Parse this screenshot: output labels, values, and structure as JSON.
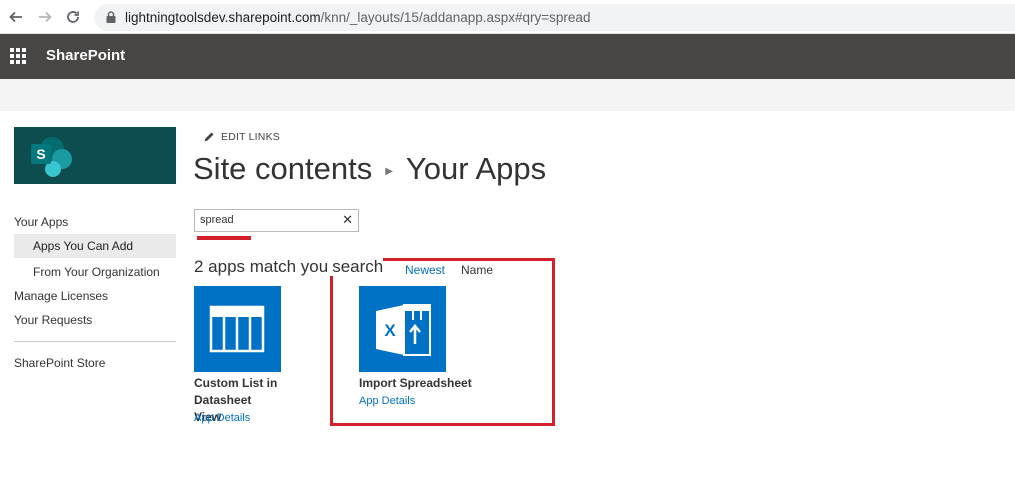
{
  "browser": {
    "url_host": "lightningtoolsdev.sharepoint.com",
    "url_path": "/knn/_layouts/15/addanapp.aspx#qry=spread"
  },
  "suite_bar": {
    "title": "SharePoint"
  },
  "left_nav": {
    "items": [
      {
        "label": "Your Apps"
      },
      {
        "label": "Apps You Can Add"
      },
      {
        "label": "From Your Organization"
      },
      {
        "label": "Manage Licenses"
      },
      {
        "label": "Your Requests"
      },
      {
        "label": "SharePoint Store"
      }
    ]
  },
  "main": {
    "edit_links_label": "EDIT LINKS",
    "breadcrumb_root": "Site contents",
    "breadcrumb_current": "Your Apps",
    "search_value": "spread",
    "match_text": "2 apps match you",
    "match_text_tail": "search",
    "sort_newest": "Newest",
    "sort_name": "Name",
    "apps": [
      {
        "name_line1": "Custom List in Datasheet",
        "name_line2": "View",
        "details": "App Details"
      },
      {
        "name_line1": "Import Spreadsheet",
        "name_line2": "",
        "details": "App Details"
      }
    ]
  },
  "colors": {
    "suite_bar": "#484644",
    "accent_blue": "#0072c6",
    "highlight_red": "#d3202a",
    "site_logo_bg": "#0e4d4f"
  }
}
